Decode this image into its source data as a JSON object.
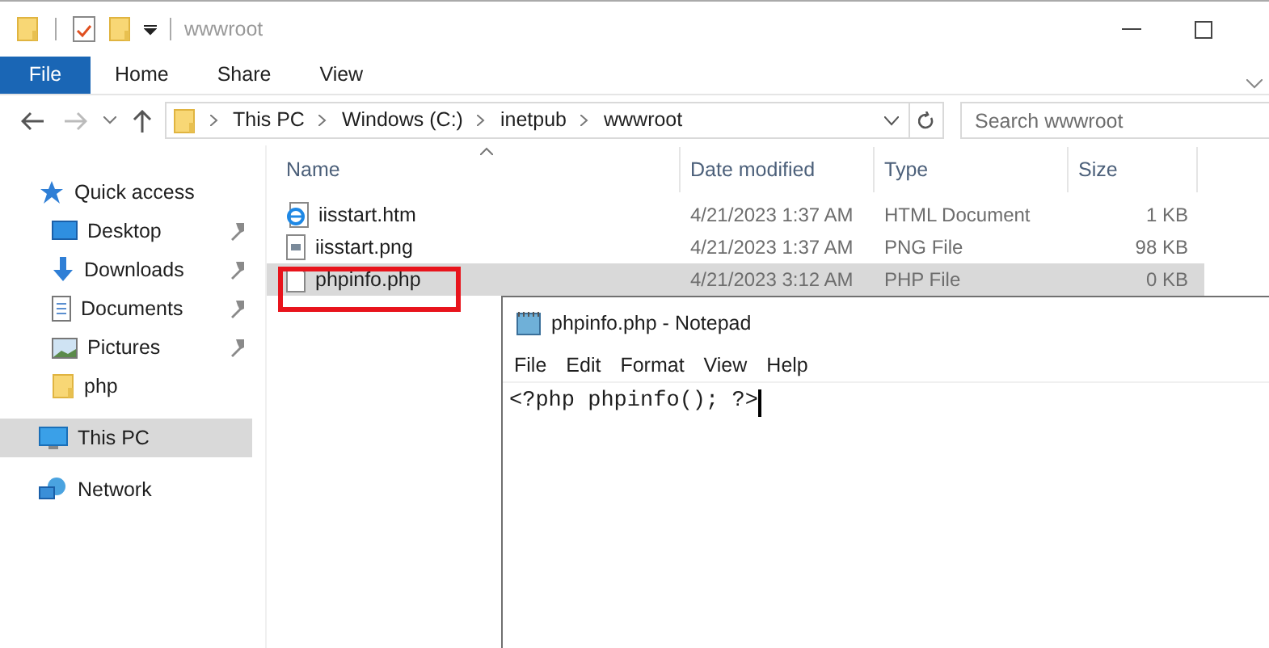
{
  "window": {
    "title": "wwwroot"
  },
  "ribbon_tabs": [
    {
      "label": "File",
      "selected": true
    },
    {
      "label": "Home",
      "selected": false
    },
    {
      "label": "Share",
      "selected": false
    },
    {
      "label": "View",
      "selected": false
    }
  ],
  "address": {
    "path": [
      "This PC",
      "Windows (C:)",
      "inetpub",
      "wwwroot"
    ]
  },
  "search": {
    "placeholder": "Search wwwroot"
  },
  "sidebar": {
    "items": [
      {
        "label": "Quick access",
        "kind": "star",
        "selected": false,
        "children": [
          {
            "label": "Desktop",
            "kind": "desktop",
            "pinned": true,
            "selected": false
          },
          {
            "label": "Downloads",
            "kind": "download",
            "pinned": true,
            "selected": false
          },
          {
            "label": "Documents",
            "kind": "document",
            "pinned": true,
            "selected": false
          },
          {
            "label": "Pictures",
            "kind": "pictures",
            "pinned": true,
            "selected": false
          },
          {
            "label": "php",
            "kind": "folder",
            "pinned": false,
            "selected": false
          }
        ]
      },
      {
        "label": "This PC",
        "kind": "pc",
        "selected": true
      },
      {
        "label": "Network",
        "kind": "network",
        "selected": false
      }
    ]
  },
  "table": {
    "columns": [
      "Name",
      "Date modified",
      "Type",
      "Size"
    ],
    "rows": [
      {
        "name": "iisstart.htm",
        "kind": "html",
        "date": "4/21/2023 1:37 AM",
        "type": "HTML Document",
        "size": "1 KB",
        "selected": false,
        "highlighted": false
      },
      {
        "name": "iisstart.png",
        "kind": "image",
        "date": "4/21/2023 1:37 AM",
        "type": "PNG File",
        "size": "98 KB",
        "selected": false,
        "highlighted": false
      },
      {
        "name": "phpinfo.php",
        "kind": "file",
        "date": "4/21/2023 3:12 AM",
        "type": "PHP File",
        "size": "0 KB",
        "selected": true,
        "highlighted": true
      }
    ]
  },
  "notepad": {
    "title": "phpinfo.php - Notepad",
    "menu": [
      "File",
      "Edit",
      "Format",
      "View",
      "Help"
    ],
    "text": "<?php phpinfo(); ?>"
  }
}
